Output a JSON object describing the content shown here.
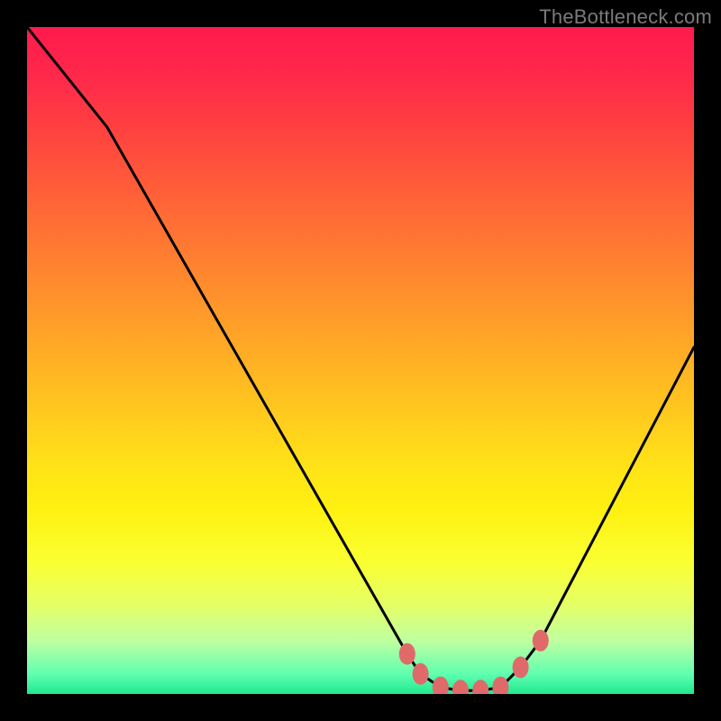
{
  "watermark": "TheBottleneck.com",
  "colors": {
    "frame": "#000000",
    "line": "#000000",
    "marker": "#e06a6a",
    "watermark": "#7a7a7a"
  },
  "chart_data": {
    "type": "line",
    "title": "",
    "xlabel": "",
    "ylabel": "",
    "xlim": [
      0,
      100
    ],
    "ylim": [
      0,
      100
    ],
    "grid": false,
    "series": [
      {
        "name": "bottleneck-curve",
        "x": [
          0,
          12,
          57,
          59,
          62,
          65,
          68,
          71,
          74,
          77,
          100
        ],
        "values": [
          100,
          85,
          6,
          3,
          1,
          0.5,
          0.5,
          1,
          4,
          8,
          52
        ]
      }
    ],
    "markers": {
      "name": "highlight-dots",
      "color": "#e06a6a",
      "points": [
        {
          "x": 57,
          "y": 6
        },
        {
          "x": 59,
          "y": 3
        },
        {
          "x": 62,
          "y": 1
        },
        {
          "x": 65,
          "y": 0.5
        },
        {
          "x": 68,
          "y": 0.5
        },
        {
          "x": 71,
          "y": 1
        },
        {
          "x": 74,
          "y": 4
        },
        {
          "x": 77,
          "y": 8
        }
      ]
    },
    "background_gradient": {
      "top": "#ff1a4d",
      "mid": "#ffe018",
      "bottom": "#20e890"
    }
  }
}
